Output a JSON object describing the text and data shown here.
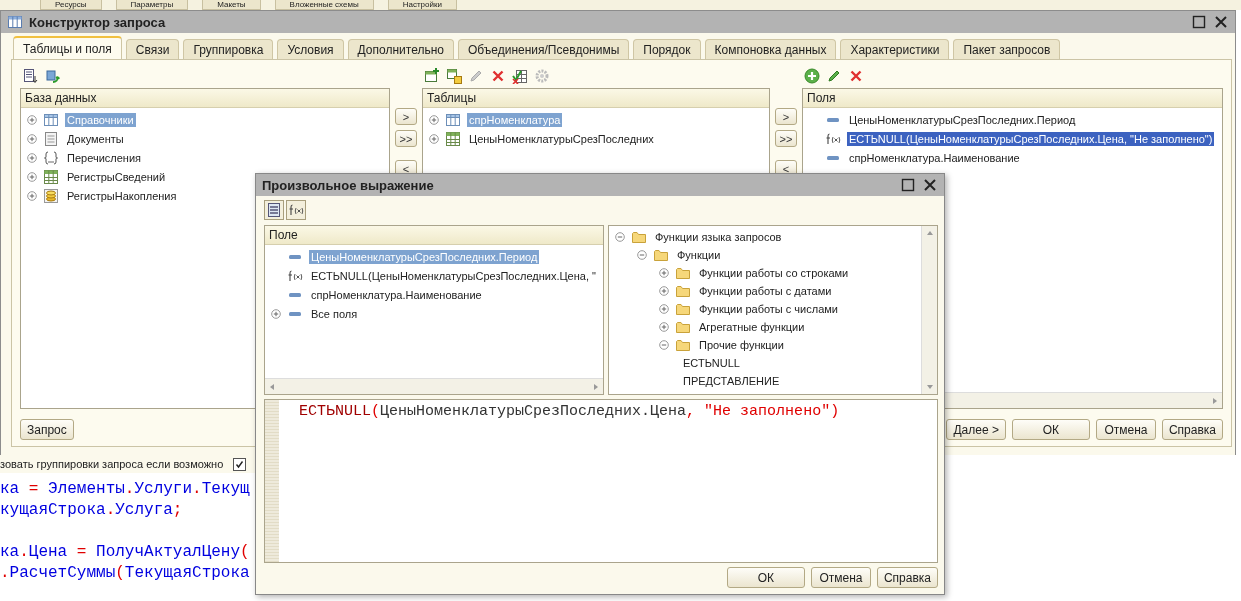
{
  "background_tabs": [
    "Ресурсы",
    "Параметры",
    "Макеты",
    "Вложенные схемы",
    "Настройки"
  ],
  "main_window": {
    "title": "Конструктор запроса",
    "tabs": [
      {
        "label": "Таблицы и поля",
        "selected": true
      },
      {
        "label": "Связи",
        "selected": false
      },
      {
        "label": "Группировка",
        "selected": false
      },
      {
        "label": "Условия",
        "selected": false
      },
      {
        "label": "Дополнительно",
        "selected": false
      },
      {
        "label": "Объединения/Псевдонимы",
        "selected": false
      },
      {
        "label": "Порядок",
        "selected": false
      },
      {
        "label": "Компоновка данных",
        "selected": false
      },
      {
        "label": "Характеристики",
        "selected": false
      },
      {
        "label": "Пакет запросов",
        "selected": false
      }
    ],
    "database_panel": {
      "header": "База данных",
      "items": [
        {
          "label": "Справочники",
          "kind": "catalog",
          "expanded": false,
          "selected": true
        },
        {
          "label": "Документы",
          "kind": "document",
          "expanded": false,
          "selected": false
        },
        {
          "label": "Перечисления",
          "kind": "enum",
          "expanded": false,
          "selected": false
        },
        {
          "label": "РегистрыСведений",
          "kind": "info_register",
          "expanded": false,
          "selected": false
        },
        {
          "label": "РегистрыНакопления",
          "kind": "accumulation_register",
          "expanded": false,
          "selected": false
        }
      ]
    },
    "database_move_buttons": [
      ">",
      ">>",
      "<"
    ],
    "tables_panel": {
      "header": "Таблицы",
      "items": [
        {
          "label": "спрНоменклатура",
          "kind": "catalog",
          "expanded": false,
          "selected": true
        },
        {
          "label": "ЦеныНоменклатурыСрезПоследних",
          "kind": "info_register",
          "expanded": false,
          "selected": false
        }
      ]
    },
    "tables_move_buttons": [
      ">",
      ">>",
      "<"
    ],
    "fields_panel": {
      "header": "Поля",
      "items": [
        {
          "label": "ЦеныНоменклатурыСрезПоследних.Период",
          "kind": "field",
          "selected": false
        },
        {
          "label": "ЕСТЬNULL(ЦеныНоменклатурыСрезПоследних.Цена, \"Не заполнено\")",
          "kind": "expression",
          "selected": true
        },
        {
          "label": "спрНоменклатура.Наименование",
          "kind": "field",
          "selected": false
        }
      ]
    },
    "query_button": "Запрос",
    "buttons": [
      "Далее >",
      "ОК",
      "Отмена",
      "Справка"
    ]
  },
  "background_form": {
    "option_label": "зовать группировки запроса если возможно",
    "option_checked": true,
    "code_lines": [
      {
        "kind": "code",
        "tokens": [
          {
            "text": "ка ",
            "kind": "id"
          },
          {
            "text": "=",
            "kind": "op"
          },
          {
            "text": " Элементы",
            "kind": "id"
          },
          {
            "text": ".",
            "kind": "op"
          },
          {
            "text": "Услуги",
            "kind": "id"
          },
          {
            "text": ".",
            "kind": "op"
          },
          {
            "text": "Текущ",
            "kind": "id"
          }
        ]
      },
      {
        "kind": "code",
        "tokens": [
          {
            "text": "кущаяСтрока",
            "kind": "id"
          },
          {
            "text": ".",
            "kind": "op"
          },
          {
            "text": "Услуга",
            "kind": "id"
          },
          {
            "text": ";",
            "kind": "op"
          }
        ]
      },
      {
        "kind": "blank"
      },
      {
        "kind": "code",
        "tokens": [
          {
            "text": "ка",
            "kind": "id"
          },
          {
            "text": ".",
            "kind": "op"
          },
          {
            "text": "Цена ",
            "kind": "id"
          },
          {
            "text": "=",
            "kind": "op"
          },
          {
            "text": " ПолучАктуалЦену",
            "kind": "id"
          },
          {
            "text": "(",
            "kind": "op"
          }
        ]
      },
      {
        "kind": "code",
        "tokens": [
          {
            "text": ".",
            "kind": "op"
          },
          {
            "text": "РасчетСуммы",
            "kind": "id"
          },
          {
            "text": "(",
            "kind": "op"
          },
          {
            "text": "ТекущаяСтрока",
            "kind": "id"
          }
        ]
      }
    ]
  },
  "dialog": {
    "title": "Произвольное выражение",
    "fields_panel": {
      "header": "Поле",
      "items": [
        {
          "label": "ЦеныНоменклатурыСрезПоследних.Период",
          "kind": "field",
          "selected": true
        },
        {
          "label": "ЕСТЬNULL(ЦеныНоменклатурыСрезПоследних.Цена, \"",
          "kind": "expression",
          "selected": false
        },
        {
          "label": "спрНоменклатура.Наименование",
          "kind": "field",
          "selected": false
        },
        {
          "label": "Все поля",
          "kind": "field",
          "expanded": false,
          "selected": false
        }
      ]
    },
    "functions_tree": [
      {
        "label": "Функции языка запросов",
        "kind": "folder",
        "expanded": true,
        "children": [
          {
            "label": "Функции",
            "kind": "folder",
            "expanded": true,
            "children": [
              {
                "label": "Функции работы со строками",
                "kind": "folder",
                "expanded": false
              },
              {
                "label": "Функции работы с датами",
                "kind": "folder",
                "expanded": false
              },
              {
                "label": "Функции работы с числами",
                "kind": "folder",
                "expanded": false
              },
              {
                "label": "Агрегатные функции",
                "kind": "folder",
                "expanded": false
              },
              {
                "label": "Прочие функции",
                "kind": "folder",
                "expanded": true,
                "children": [
                  {
                    "label": "ЕСТЬNULL"
                  },
                  {
                    "label": "ПРЕДСТАВЛЕНИЕ"
                  }
                ]
              }
            ]
          }
        ]
      }
    ],
    "expression": [
      {
        "text": "ЕСТЬNULL",
        "kind": "keyword"
      },
      {
        "text": "(",
        "kind": "punct"
      },
      {
        "text": "ЦеныНоменклатурыСрезПоследних.Цена",
        "kind": "ident"
      },
      {
        "text": ", ",
        "kind": "punct"
      },
      {
        "text": "\"Не заполнено\"",
        "kind": "string"
      },
      {
        "text": ")",
        "kind": "punct"
      }
    ],
    "buttons": [
      "ОК",
      "Отмена",
      "Справка"
    ]
  }
}
